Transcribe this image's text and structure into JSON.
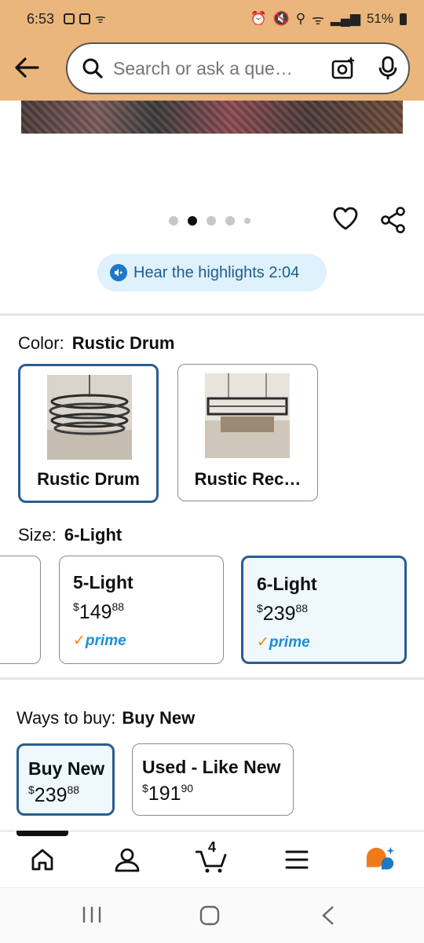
{
  "status_bar": {
    "time": "6:53",
    "battery": "51%"
  },
  "search": {
    "placeholder": "Search or ask a que…"
  },
  "carousel": {
    "total_dots": 5,
    "active_index": 1
  },
  "highlights": {
    "label": "Hear the highlights 2:04"
  },
  "color": {
    "label": "Color:",
    "selected": "Rustic Drum",
    "options": [
      {
        "name": "Rustic Drum",
        "selected": true
      },
      {
        "name": "Rustic Rec…",
        "selected": false
      }
    ]
  },
  "size": {
    "label": "Size:",
    "selected": "6-Light",
    "options": [
      {
        "name": "5-Light",
        "price_whole": "149",
        "price_cents": "88",
        "currency": "$",
        "prime": "prime",
        "selected": false
      },
      {
        "name": "6-Light",
        "price_whole": "239",
        "price_cents": "88",
        "currency": "$",
        "prime": "prime",
        "selected": true
      }
    ]
  },
  "ways_to_buy": {
    "label": "Ways to buy:",
    "selected": "Buy New",
    "options": [
      {
        "name": "Buy New",
        "currency": "$",
        "price_whole": "239",
        "price_cents": "88",
        "selected": true
      },
      {
        "name": "Used - Like New",
        "currency": "$",
        "price_whole": "191",
        "price_cents": "90",
        "selected": false
      }
    ]
  },
  "bottom_nav": {
    "items": [
      {
        "icon": "home-icon"
      },
      {
        "icon": "account-icon"
      },
      {
        "icon": "cart-icon",
        "count": "4"
      },
      {
        "icon": "menu-icon"
      },
      {
        "icon": "rufus-icon"
      }
    ]
  },
  "colors": {
    "header_bg": "#eab67c",
    "selected_border": "#2a5d8f",
    "prime_blue": "#1a8fd4",
    "prime_check": "#f08804"
  }
}
